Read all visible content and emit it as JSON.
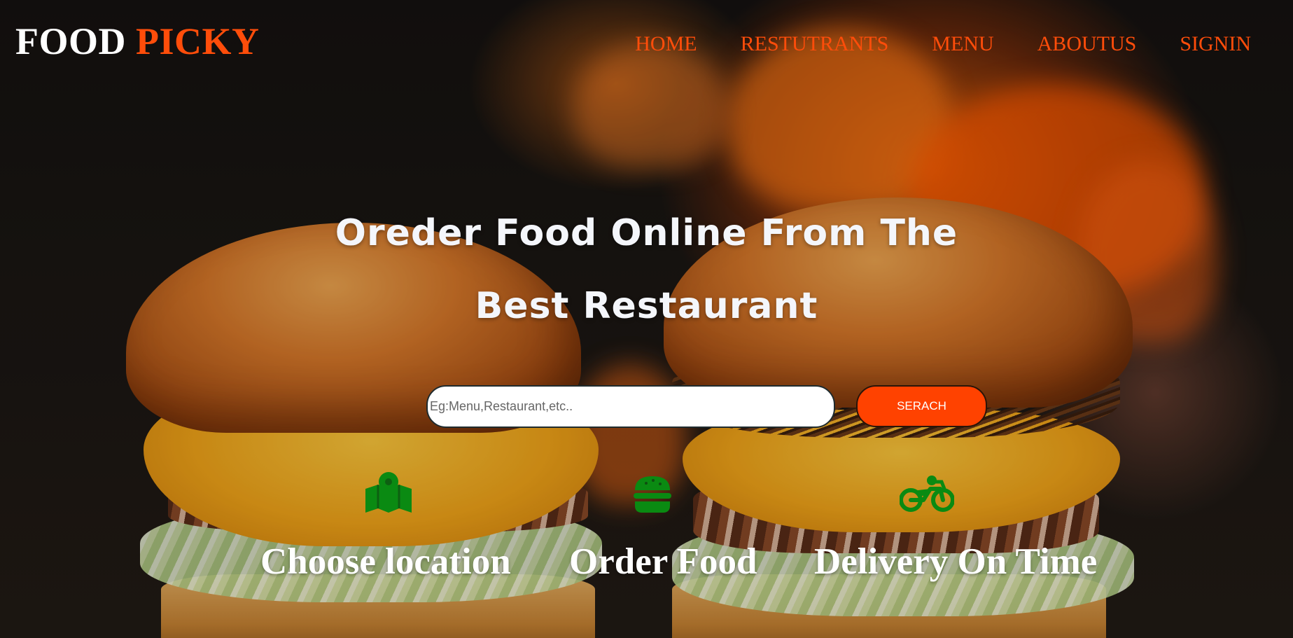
{
  "brand": {
    "part1": "FOOD",
    "part2": "PICKY"
  },
  "nav": {
    "items": [
      {
        "label": "HOME"
      },
      {
        "label": "RESTUTRANTS"
      },
      {
        "label": "MENU"
      },
      {
        "label": "ABOUTUS"
      },
      {
        "label": "SIGNIN"
      }
    ]
  },
  "hero": {
    "title_line1": "Oreder Food Online From The",
    "title_line2": "Best Restaurant"
  },
  "search": {
    "placeholder": "Eg:Menu,Restaurant,etc..",
    "value": "",
    "button_label": "SERACH"
  },
  "features": [
    {
      "icon": "map-marker-icon",
      "label": "Choose location"
    },
    {
      "icon": "burger-icon",
      "label": "Order Food"
    },
    {
      "icon": "motorcycle-icon",
      "label": "Delivery On Time"
    }
  ],
  "colors": {
    "brand_white": "#ffffff",
    "accent_orange": "#ff4d0a",
    "button_orange": "#ff4200",
    "icon_green": "#0a8a12",
    "hero_text": "#f4f6fb"
  }
}
